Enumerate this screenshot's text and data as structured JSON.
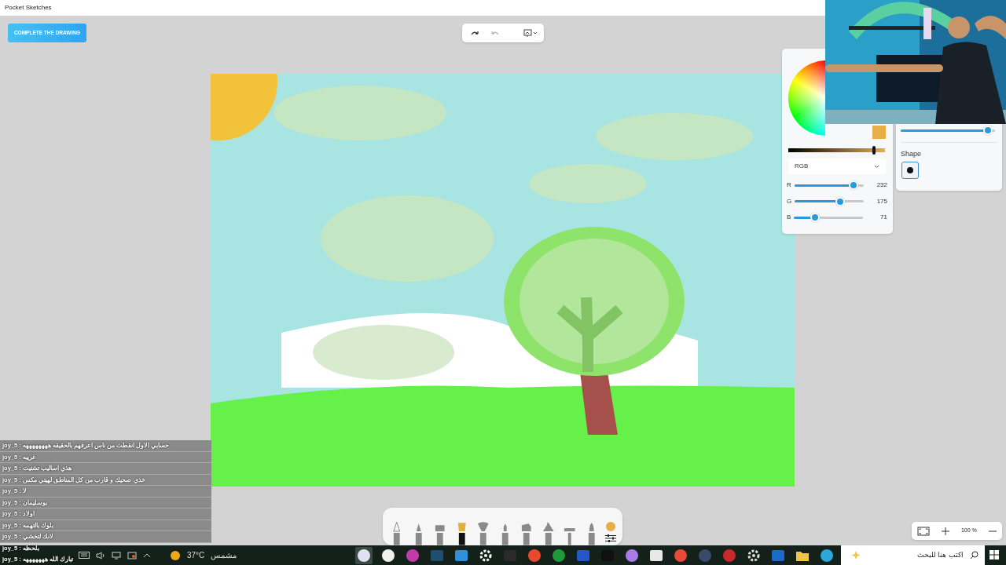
{
  "window": {
    "title": "Pocket Sketches"
  },
  "complete_button": {
    "label": "COMPLETE THE DRAWING"
  },
  "top_toolbar": {
    "undo_disabled": false,
    "redo_disabled": true
  },
  "color_panel": {
    "brightness": {
      "level": 0.89
    },
    "mode": "RGB",
    "channels": [
      {
        "label": "R",
        "level": 0.91,
        "reading": "232"
      },
      {
        "label": "G",
        "level": 0.686,
        "reading": "175"
      },
      {
        "label": "B",
        "level": 0.278,
        "reading": "71"
      }
    ]
  },
  "brush_panel": {
    "size": {
      "level": 0.97
    },
    "shape_title": "Shape",
    "shapes": [
      {
        "selected": true
      }
    ]
  },
  "tools": [
    {
      "kind": "pencil",
      "selected": false
    },
    {
      "kind": "pen",
      "selected": false
    },
    {
      "kind": "marker",
      "selected": false
    },
    {
      "kind": "brush",
      "selected": true
    },
    {
      "kind": "fan",
      "selected": false
    },
    {
      "kind": "felt",
      "selected": false
    },
    {
      "kind": "chisel",
      "selected": false
    },
    {
      "kind": "cone",
      "selected": false
    },
    {
      "kind": "eraser",
      "selected": false
    },
    {
      "kind": "round",
      "selected": false
    }
  ],
  "zoom": {
    "reading": "100 %"
  },
  "chat": [
    {
      "text": "joy_5 : حسابي الاول انقطت من ناس اعرفهم بالحقيقه ههههههههه",
      "backed": true
    },
    {
      "text": "joy_5 : غريبه",
      "backed": true
    },
    {
      "text": "joy_5 : هذي اساليب تشتيت",
      "backed": true
    },
    {
      "text": "joy_5 : خذي صحيك و قارب من كل المناطق لهيتي مكس",
      "backed": true
    },
    {
      "text": "joy_5 : لا",
      "backed": true
    },
    {
      "text": "joy_5 : بوسليمان",
      "backed": true
    },
    {
      "text": "joy_5 : اولاد",
      "backed": true
    },
    {
      "text": "joy_5 : بلوك بالتهمه",
      "backed": true
    },
    {
      "text": "joy_5 : لانك لتخشي",
      "backed": true
    },
    {
      "text": "joy_5 : بلحظه",
      "backed": false
    },
    {
      "text": "joy_5 : تبارك الله هههههههه",
      "backed": false
    }
  ],
  "taskbar": {
    "temperature": "37°C",
    "weather": "مشمس",
    "search_placeholder": "اكتب هنا للبحث",
    "apps": [
      {
        "kind": "round",
        "color": "#e0e0f0",
        "selected": true
      },
      {
        "kind": "round",
        "color": "#f0f0f0",
        "selected": false
      },
      {
        "kind": "round",
        "color": "#c43aa8",
        "selected": false
      },
      {
        "kind": "tile",
        "color": "#1e4f6e",
        "selected": false
      },
      {
        "kind": "tile",
        "color": "#2f8fd8",
        "selected": false
      },
      {
        "kind": "gear",
        "color": "#ffffff",
        "selected": false
      },
      {
        "kind": "tile",
        "color": "#2a2a2a",
        "selected": false
      },
      {
        "kind": "round",
        "color": "#e8492c",
        "selected": false
      },
      {
        "kind": "round",
        "color": "#1f9a3a",
        "selected": false
      },
      {
        "kind": "tile",
        "color": "#2458c8",
        "selected": false
      },
      {
        "kind": "tile",
        "color": "#111111",
        "selected": false
      },
      {
        "kind": "round",
        "color": "#a77be8",
        "selected": false
      },
      {
        "kind": "tile",
        "color": "#e8e8e8",
        "selected": false
      },
      {
        "kind": "round",
        "color": "#e84a3a",
        "selected": false
      },
      {
        "kind": "round",
        "color": "#3a4a6a",
        "selected": false
      },
      {
        "kind": "round",
        "color": "#c82a2a",
        "selected": false
      },
      {
        "kind": "gear",
        "color": "#dddddd",
        "selected": false
      },
      {
        "kind": "tile",
        "color": "#1a6ac8",
        "selected": false
      },
      {
        "kind": "folder",
        "color": "#f2c34a",
        "selected": false
      },
      {
        "kind": "round",
        "color": "#2aa8d8",
        "selected": false
      }
    ]
  }
}
